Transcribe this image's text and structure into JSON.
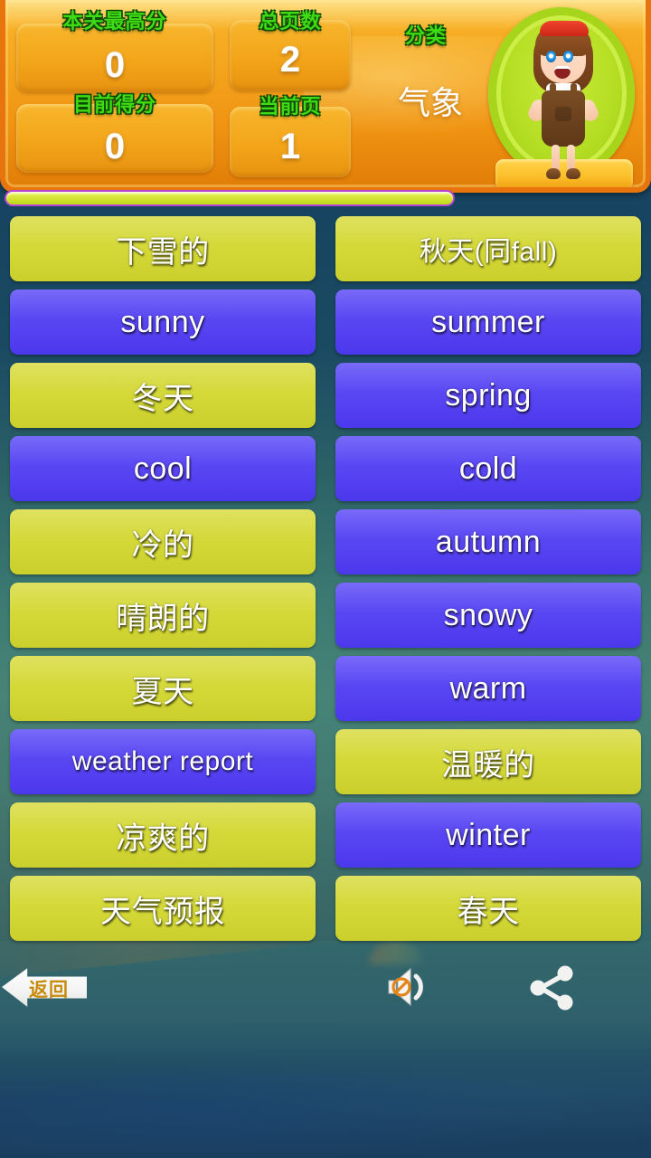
{
  "app": {
    "category_name": "气象"
  },
  "hud": {
    "best_score_label": "本关最高分",
    "best_score_value": "0",
    "current_score_label": "目前得分",
    "current_score_value": "0",
    "total_pages_label": "总页数",
    "total_pages_value": "2",
    "current_page_label": "当前页",
    "current_page_value": "1",
    "category_label": "分类",
    "category_value": "气象",
    "label_color": "#3fdb14",
    "value_color": "#ffffff",
    "panel_color": "#f3a519",
    "progress_percent": 100,
    "progress_fill_color": "#dbe83c",
    "progress_border_color": "#b445d6"
  },
  "board": {
    "card_colors": {
      "chinese": "#d3d836",
      "english": "#5744f2"
    },
    "left_column": [
      {
        "text": "下雪的",
        "lang": "cn"
      },
      {
        "text": "sunny",
        "lang": "en"
      },
      {
        "text": "冬天",
        "lang": "cn"
      },
      {
        "text": "cool",
        "lang": "en"
      },
      {
        "text": "冷的",
        "lang": "cn"
      },
      {
        "text": "晴朗的",
        "lang": "cn"
      },
      {
        "text": "夏天",
        "lang": "cn"
      },
      {
        "text": "weather report",
        "lang": "en",
        "small": true
      },
      {
        "text": "凉爽的",
        "lang": "cn"
      },
      {
        "text": "天气预报",
        "lang": "cn"
      }
    ],
    "right_column": [
      {
        "text": "秋天(同fall)",
        "lang": "cn",
        "small": true
      },
      {
        "text": "summer",
        "lang": "en"
      },
      {
        "text": "spring",
        "lang": "en"
      },
      {
        "text": "cold",
        "lang": "en"
      },
      {
        "text": "autumn",
        "lang": "en"
      },
      {
        "text": "snowy",
        "lang": "en"
      },
      {
        "text": "warm",
        "lang": "en"
      },
      {
        "text": "温暖的",
        "lang": "cn"
      },
      {
        "text": "winter",
        "lang": "en"
      },
      {
        "text": "春天",
        "lang": "cn"
      }
    ]
  },
  "bottom_bar": {
    "back_label": "返回",
    "back_icon": "left-arrow-icon",
    "sound_icon": "speaker-muted-icon",
    "sound_state": "muted",
    "share_icon": "share-icon",
    "back_label_color": "#c78b0c"
  }
}
